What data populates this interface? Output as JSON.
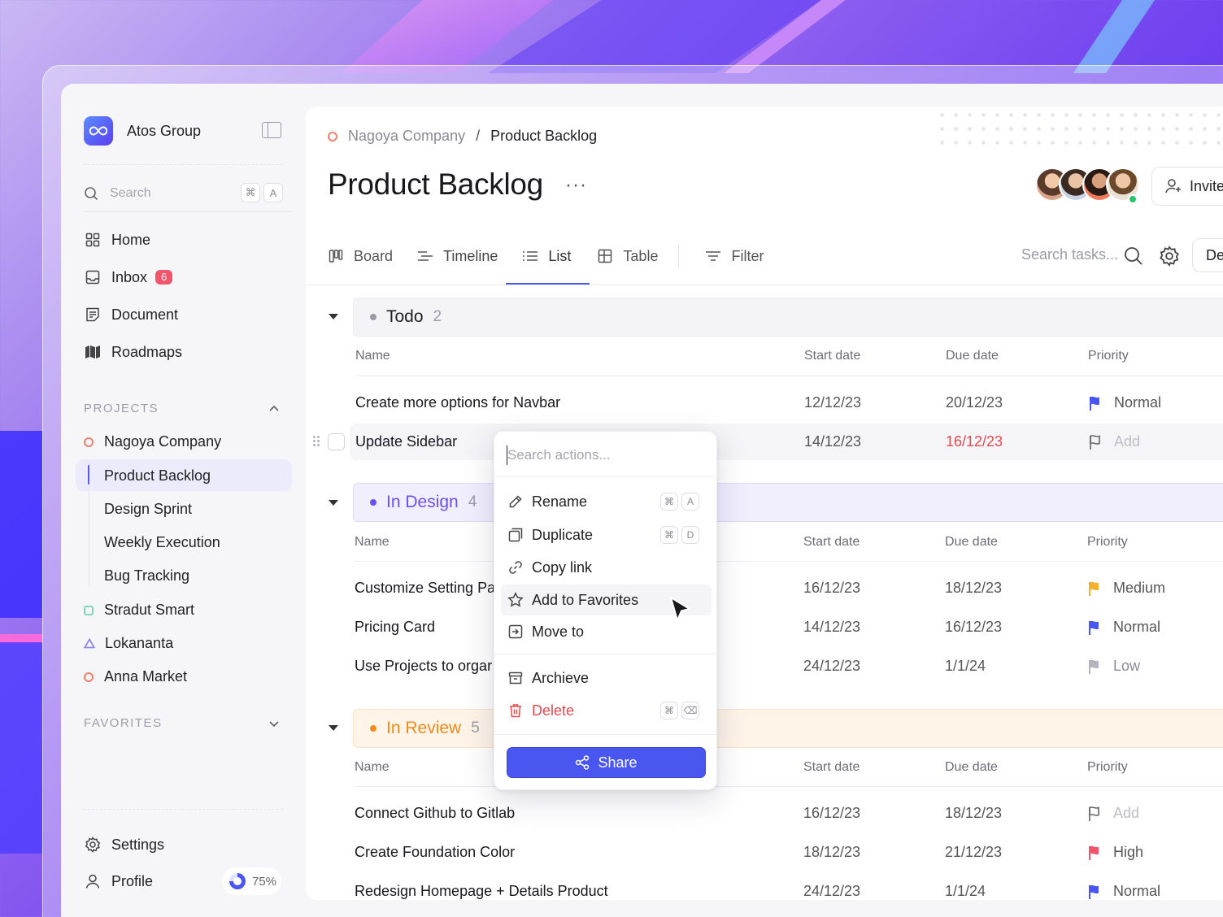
{
  "sidebar": {
    "brand": "Atos Group",
    "search": {
      "placeholder": "Search",
      "kbd1": "⌘",
      "kbd2": "A"
    },
    "nav": [
      {
        "label": "Home",
        "icon": "grid-icon"
      },
      {
        "label": "Inbox",
        "icon": "inbox-icon",
        "badge": "6"
      },
      {
        "label": "Document",
        "icon": "document-icon"
      },
      {
        "label": "Roadmaps",
        "icon": "map-icon"
      }
    ],
    "projects_label": "PROJECTS",
    "projects": [
      {
        "label": "Nagoya Company",
        "color": "#f0806a"
      },
      {
        "label": "Stradut Smart",
        "color": "#7fd6b6"
      },
      {
        "label": "Lokananta",
        "color": "#8a8af0"
      },
      {
        "label": "Anna Market",
        "color": "#f0806a"
      }
    ],
    "subprojects": [
      "Product Backlog",
      "Design Sprint",
      "Weekly Execution",
      "Bug Tracking"
    ],
    "favorites_label": "FAVORITES",
    "settings": "Settings",
    "profile": "Profile",
    "storage": "75%"
  },
  "header": {
    "breadcrumb_parent": "Nagoya Company",
    "breadcrumb_sep": "/",
    "breadcrumb_current": "Product Backlog",
    "title": "Product Backlog",
    "more": "···",
    "invite": "Invite"
  },
  "tabs": [
    "Board",
    "Timeline",
    "List",
    "Table"
  ],
  "filter": "Filter",
  "task_search_placeholder": "Search tasks...",
  "de_button": "De",
  "columns": {
    "name": "Name",
    "start": "Start date",
    "due": "Due date",
    "priority": "Priority"
  },
  "groups": [
    {
      "label": "Todo",
      "count": "2",
      "color": "#9a9aa4",
      "rows": [
        {
          "name": "Create more options for Navbar",
          "start": "12/12/23",
          "due": "20/12/23",
          "priority": "Normal",
          "flag": "#4a56f0"
        },
        {
          "name": "Update Sidebar",
          "start": "14/12/23",
          "due": "16/12/23",
          "priority": "Add",
          "flag": "outline"
        }
      ]
    },
    {
      "label": "In Design",
      "count": "4",
      "color": "#6b4ff0",
      "rows": [
        {
          "name": "Customize Setting Pa",
          "start": "16/12/23",
          "due": "18/12/23",
          "priority": "Medium",
          "flag": "#f5b02e"
        },
        {
          "name": "Pricing Card",
          "start": "14/12/23",
          "due": "16/12/23",
          "priority": "Normal",
          "flag": "#4a56f0"
        },
        {
          "name": "Use Projects to orgar",
          "start": "24/12/23",
          "due": "1/1/24",
          "priority": "Low",
          "flag": "#b4b4bc"
        }
      ]
    },
    {
      "label": "In Review",
      "count": "5",
      "color": "#f08a1c",
      "rows": [
        {
          "name": "Connect Github to Gitlab",
          "start": "16/12/23",
          "due": "18/12/23",
          "priority": "Add",
          "flag": "outline"
        },
        {
          "name": "Create Foundation Color",
          "start": "18/12/23",
          "due": "21/12/23",
          "priority": "High",
          "flag": "#f0556b"
        },
        {
          "name": "Redesign Homepage + Details Product",
          "start": "24/12/23",
          "due": "1/1/24",
          "priority": "Normal",
          "flag": "#4a56f0"
        }
      ]
    }
  ],
  "menu": {
    "search_placeholder": "Search actions...",
    "rename": "Rename",
    "rename_k1": "⌘",
    "rename_k2": "A",
    "duplicate": "Duplicate",
    "duplicate_k1": "⌘",
    "duplicate_k2": "D",
    "copy_link": "Copy link",
    "favorites": "Add to Favorites",
    "move_to": "Move to",
    "archive": "Archieve",
    "delete": "Delete",
    "delete_k1": "⌘",
    "delete_k2": "⌫",
    "share": "Share"
  }
}
